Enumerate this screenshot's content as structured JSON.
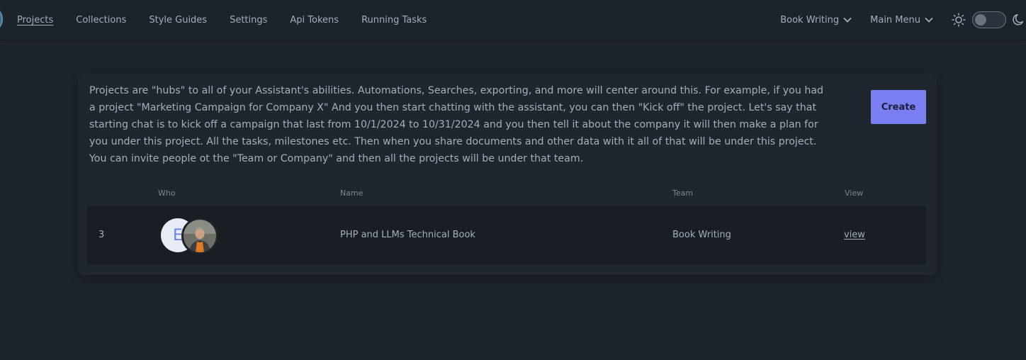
{
  "nav": {
    "links": [
      "Projects",
      "Collections",
      "Style Guides",
      "Settings",
      "Api Tokens",
      "Running Tasks"
    ],
    "active": "Projects",
    "team_dropdown": "Book Writing",
    "main_menu": "Main Menu",
    "theme": "dark"
  },
  "projects": {
    "description": "Projects are \"hubs\" to all of your Assistant's abilities. Automations, Searches, exporting, and more will center around this. For example, if you had a project \"Marketing Campaign for Company X\" And you then start chatting with the assistant, you can then \"Kick off\" the project. Let's say that starting chat is to kick off a campaign that last from 10/1/2024 to 10/31/2024 and you then tell it about the company it will then make a plan for you under this project. All the tasks, milestones etc. Then when you share documents and other data with it all of that will be under this project. You can invite people ot the \"Team or Company\" and then all the projects will be under that team.",
    "create_label": "Create",
    "columns": {
      "who": "Who",
      "name": "Name",
      "team": "Team",
      "view": "View"
    },
    "rows": [
      {
        "id": "3",
        "avatar_initial": "E",
        "name": "PHP and LLMs Technical Book",
        "team": "Book Writing",
        "view": "view"
      }
    ]
  },
  "colors": {
    "background": "#1d232a",
    "primary": "#7b7ff4",
    "row": "#191e24"
  }
}
